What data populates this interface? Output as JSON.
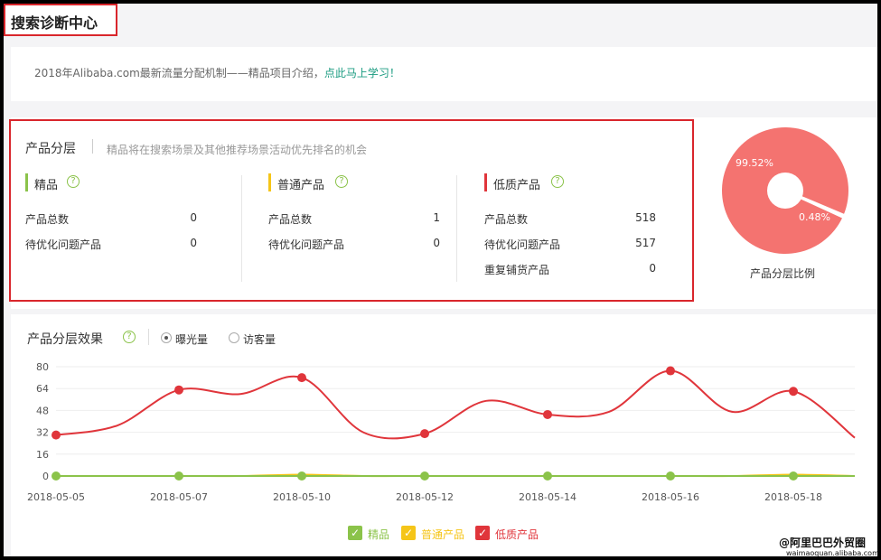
{
  "header": {
    "title": "搜索诊断中心"
  },
  "notice": {
    "text": "2018年Alibaba.com最新流量分配机制——精品项目介绍，",
    "link": "点此马上学习！"
  },
  "tiers": {
    "title": "产品分层",
    "description": "精品将在搜索场景及其他推荐场景活动优先排名的机会",
    "help_glyph": "?",
    "items": [
      {
        "name": "精品",
        "color": "#8bc34a",
        "rows": [
          {
            "label": "产品总数",
            "value": "0"
          },
          {
            "label": "待优化问题产品",
            "value": "0"
          }
        ]
      },
      {
        "name": "普通产品",
        "color": "#f5c518",
        "rows": [
          {
            "label": "产品总数",
            "value": "1"
          },
          {
            "label": "待优化问题产品",
            "value": "0"
          }
        ]
      },
      {
        "name": "低质产品",
        "color": "#e0353b",
        "rows": [
          {
            "label": "产品总数",
            "value": "518"
          },
          {
            "label": "待优化问题产品",
            "value": "517"
          },
          {
            "label": "重复铺货产品",
            "value": "0"
          }
        ]
      }
    ]
  },
  "pie": {
    "caption": "产品分层比例",
    "label_big": "99.52%",
    "label_small": "0.48%",
    "slices": [
      {
        "value": 99.52,
        "color": "#f47370"
      },
      {
        "value": 0.48,
        "color": "#ffffff"
      }
    ]
  },
  "effect": {
    "title": "产品分层效果",
    "help_glyph": "?",
    "options": [
      {
        "label": "曝光量",
        "selected": true
      },
      {
        "label": "访客量",
        "selected": false
      }
    ]
  },
  "chart_data": {
    "type": "line",
    "x": [
      "2018-05-05",
      "2018-05-06",
      "2018-05-07",
      "2018-05-08",
      "2018-05-10",
      "2018-05-11",
      "2018-05-12",
      "2018-05-13",
      "2018-05-14",
      "2018-05-15",
      "2018-05-16",
      "2018-05-17",
      "2018-05-18",
      "2018-05-19"
    ],
    "x_tick_labels": [
      "2018-05-05",
      "2018-05-07",
      "2018-05-10",
      "2018-05-12",
      "2018-05-14",
      "2018-05-16",
      "2018-05-18"
    ],
    "y_ticks": [
      "80",
      "64",
      "48",
      "32",
      "16",
      "0"
    ],
    "ylim": [
      0,
      80
    ],
    "series": [
      {
        "name": "精品",
        "color": "#8bc34a",
        "values": [
          0,
          0,
          0,
          0,
          0,
          0,
          0,
          0,
          0,
          0,
          0,
          0,
          0,
          0
        ]
      },
      {
        "name": "普通产品",
        "color": "#f5c518",
        "values": [
          0,
          0,
          0,
          0,
          1,
          0,
          0,
          0,
          0,
          0,
          0,
          0,
          1,
          0
        ]
      },
      {
        "name": "低质产品",
        "color": "#e0353b",
        "values": [
          30,
          37,
          63,
          60,
          72,
          32,
          31,
          55,
          45,
          47,
          77,
          47,
          62,
          28
        ]
      }
    ],
    "legend_placement": "bottom",
    "grid": true
  },
  "legend": {
    "check_glyph": "✓"
  },
  "watermark": {
    "main": "@阿里巴巴外贸圈",
    "sub": "waimaoquan.alibaba.com"
  }
}
